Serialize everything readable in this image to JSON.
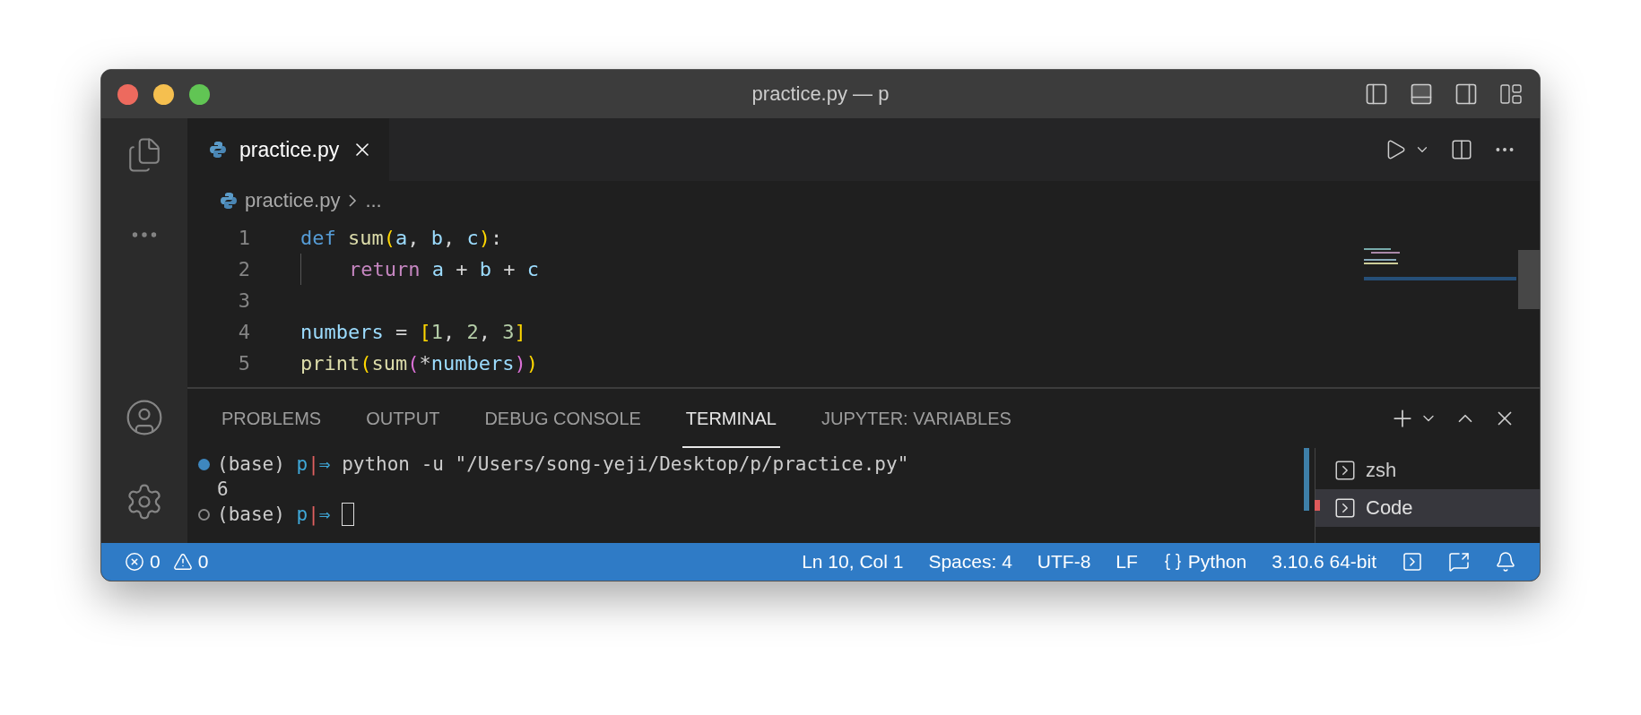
{
  "window": {
    "title": "practice.py — p"
  },
  "editor_tabs": [
    {
      "label": "practice.py",
      "selected": true
    }
  ],
  "breadcrumb": [
    "practice.py",
    "..."
  ],
  "code_lines": [
    {
      "number": "1",
      "tokens": [
        {
          "text": "def ",
          "kind": "keyword"
        },
        {
          "text": "sum",
          "kind": "function"
        },
        {
          "text": "(",
          "kind": "bracket1"
        },
        {
          "text": "a",
          "kind": "variable"
        },
        {
          "text": ", ",
          "kind": "plain"
        },
        {
          "text": "b",
          "kind": "variable"
        },
        {
          "text": ", ",
          "kind": "plain"
        },
        {
          "text": "c",
          "kind": "variable"
        },
        {
          "text": ")",
          "kind": "bracket1"
        },
        {
          "text": ":",
          "kind": "plain"
        }
      ]
    },
    {
      "number": "2",
      "indented": true,
      "tokens": [
        {
          "text": "return ",
          "kind": "control"
        },
        {
          "text": "a",
          "kind": "variable"
        },
        {
          "text": " + ",
          "kind": "plain"
        },
        {
          "text": "b",
          "kind": "variable"
        },
        {
          "text": " + ",
          "kind": "plain"
        },
        {
          "text": "c",
          "kind": "variable"
        }
      ]
    },
    {
      "number": "3"
    },
    {
      "number": "4",
      "tokens": [
        {
          "text": "numbers",
          "kind": "variable"
        },
        {
          "text": " = ",
          "kind": "plain"
        },
        {
          "text": "[",
          "kind": "bracket1"
        },
        {
          "text": "1",
          "kind": "number"
        },
        {
          "text": ", ",
          "kind": "plain"
        },
        {
          "text": "2",
          "kind": "number"
        },
        {
          "text": ", ",
          "kind": "plain"
        },
        {
          "text": "3",
          "kind": "number"
        },
        {
          "text": "]",
          "kind": "bracket1"
        }
      ]
    },
    {
      "number": "5",
      "tokens": [
        {
          "text": "print",
          "kind": "function"
        },
        {
          "text": "(",
          "kind": "bracket1"
        },
        {
          "text": "sum",
          "kind": "function"
        },
        {
          "text": "(",
          "kind": "bracket2"
        },
        {
          "text": "*",
          "kind": "plain"
        },
        {
          "text": "numbers",
          "kind": "variable"
        },
        {
          "text": ")",
          "kind": "bracket2"
        },
        {
          "text": ")",
          "kind": "bracket1"
        }
      ]
    }
  ],
  "panel_tabs": [
    {
      "label": "PROBLEMS",
      "selected": false
    },
    {
      "label": "OUTPUT",
      "selected": false
    },
    {
      "label": "DEBUG CONSOLE",
      "selected": false
    },
    {
      "label": "TERMINAL",
      "selected": true
    },
    {
      "label": "JUPYTER: VARIABLES",
      "selected": false
    }
  ],
  "terminal_lines": [
    {
      "finished": true,
      "tokens": [
        {
          "text": "(base) ",
          "kind": "plain"
        },
        {
          "text": "p",
          "kind": "cyan"
        },
        {
          "text": "|",
          "kind": "red"
        },
        {
          "text": "⇒ ",
          "kind": "cyan"
        },
        {
          "text": "python -u \"/Users/song-yeji/Desktop/p/practice.py\"",
          "kind": "plain"
        }
      ]
    },
    {
      "tokens": [
        {
          "text": "6",
          "kind": "plain"
        }
      ]
    },
    {
      "finished": false,
      "tokens": [
        {
          "text": "(base) ",
          "kind": "plain"
        },
        {
          "text": "p",
          "kind": "cyan"
        },
        {
          "text": "|",
          "kind": "red"
        },
        {
          "text": "⇒ ",
          "kind": "cyan"
        }
      ],
      "cursor": true
    }
  ],
  "terminals": [
    {
      "label": "zsh",
      "selected": false
    },
    {
      "label": "Code",
      "selected": true
    }
  ],
  "status_bar": {
    "problems": [
      {
        "kind": "errors",
        "text": "0"
      },
      {
        "kind": "warnings",
        "text": "0"
      }
    ],
    "items": [
      {
        "kind": "text",
        "text": "Ln 10, Col 1"
      },
      {
        "kind": "text",
        "text": "Spaces: 4"
      },
      {
        "kind": "text",
        "text": "UTF-8"
      },
      {
        "kind": "text",
        "text": "LF"
      },
      {
        "kind": "language",
        "text": "Python"
      },
      {
        "kind": "text",
        "text": "3.10.6 64-bit"
      }
    ]
  }
}
